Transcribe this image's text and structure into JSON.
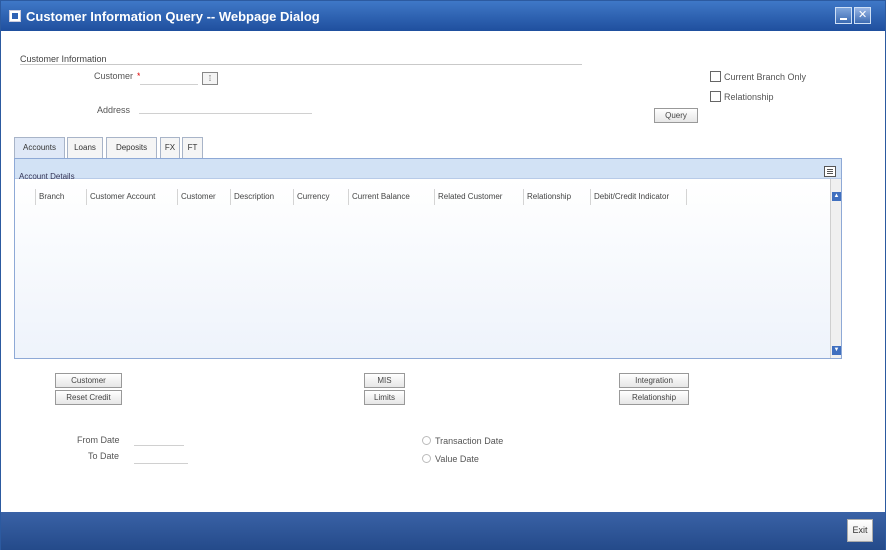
{
  "window": {
    "title": "Customer Information Query -- Webpage Dialog",
    "icon": "app-icon"
  },
  "customer_information": {
    "section_title": "Customer Information",
    "customer_label": "Customer",
    "required_mark": "*",
    "customer_value": "",
    "address_label": "Address",
    "address_value": "",
    "lov_icon": "list-of-values-icon",
    "current_branch_only_label": "Current Branch Only",
    "relationship_label": "Relationship",
    "query_button": "Query"
  },
  "tabs": [
    {
      "label": "Accounts",
      "active": true
    },
    {
      "label": "Loans"
    },
    {
      "label": "Deposits"
    },
    {
      "label": "FX"
    },
    {
      "label": "FT"
    }
  ],
  "account_details": {
    "title": "Account Details",
    "columns": [
      "Branch",
      "Customer Account",
      "Customer",
      "Description",
      "Currency",
      "Current Balance",
      "Related Customer",
      "Relationship",
      "Debit/Credit Indicator"
    ],
    "rows": []
  },
  "action_buttons": {
    "customer": "Customer",
    "reset_credit": "Reset Credit",
    "misc": "MIS",
    "limits": "Limits",
    "integration": "Integration",
    "relationship": "Relationship"
  },
  "date_filter": {
    "from_date_label": "From Date",
    "to_date_label": "To Date",
    "from_date_value": "",
    "to_date_value": "",
    "transaction_date_label": "Transaction Date",
    "value_date_label": "Value Date"
  },
  "footer": {
    "exit_button": "Exit"
  },
  "colors": {
    "title_bar": "#2f63b4",
    "panel_header": "#d2e2f5",
    "footer": "#2f5597"
  }
}
